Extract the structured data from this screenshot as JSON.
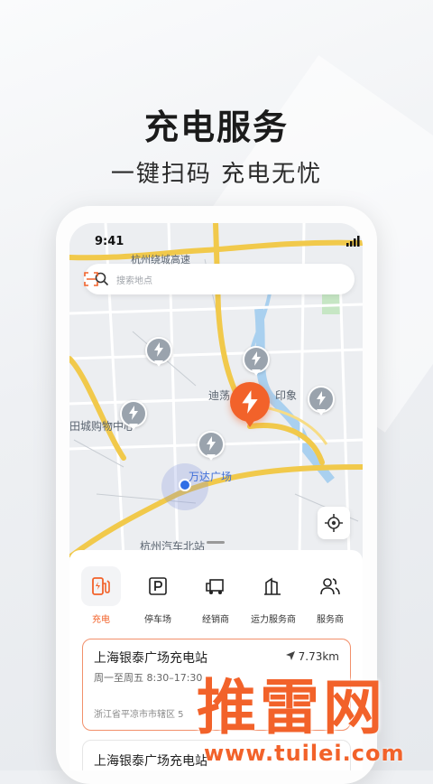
{
  "headline": "充电服务",
  "subline": "一键扫码 充电无忧",
  "status_bar": {
    "time": "9:41"
  },
  "search": {
    "placeholder": "搜索地点"
  },
  "map": {
    "labels": {
      "highway": "杭州绕城高速",
      "district": "迪荡",
      "mall": "田城购物中心",
      "plaza": "万达广场",
      "station": "杭州汽车北站",
      "suffix": "印象"
    }
  },
  "categories": [
    {
      "label": "充电",
      "icon": "charging-pile-icon",
      "active": true
    },
    {
      "label": "停车场",
      "icon": "parking-icon",
      "active": false
    },
    {
      "label": "经销商",
      "icon": "truck-icon",
      "active": false
    },
    {
      "label": "运力服务商",
      "icon": "building-icon",
      "active": false
    },
    {
      "label": "服务商",
      "icon": "people-icon",
      "active": false
    }
  ],
  "stations": [
    {
      "name": "上海银泰广场充电站",
      "distance": "7.73km",
      "hours": "周一至周五 8:30–17:30",
      "address": "浙江省平凉市市辖区 5"
    },
    {
      "name": "上海银泰广场充电站"
    }
  ],
  "watermark": {
    "brand": "推雷网",
    "url": "www.tuilei.com"
  },
  "colors": {
    "accent": "#f2622a",
    "map_road": "#f1c94b",
    "water": "#a9d0ef"
  }
}
